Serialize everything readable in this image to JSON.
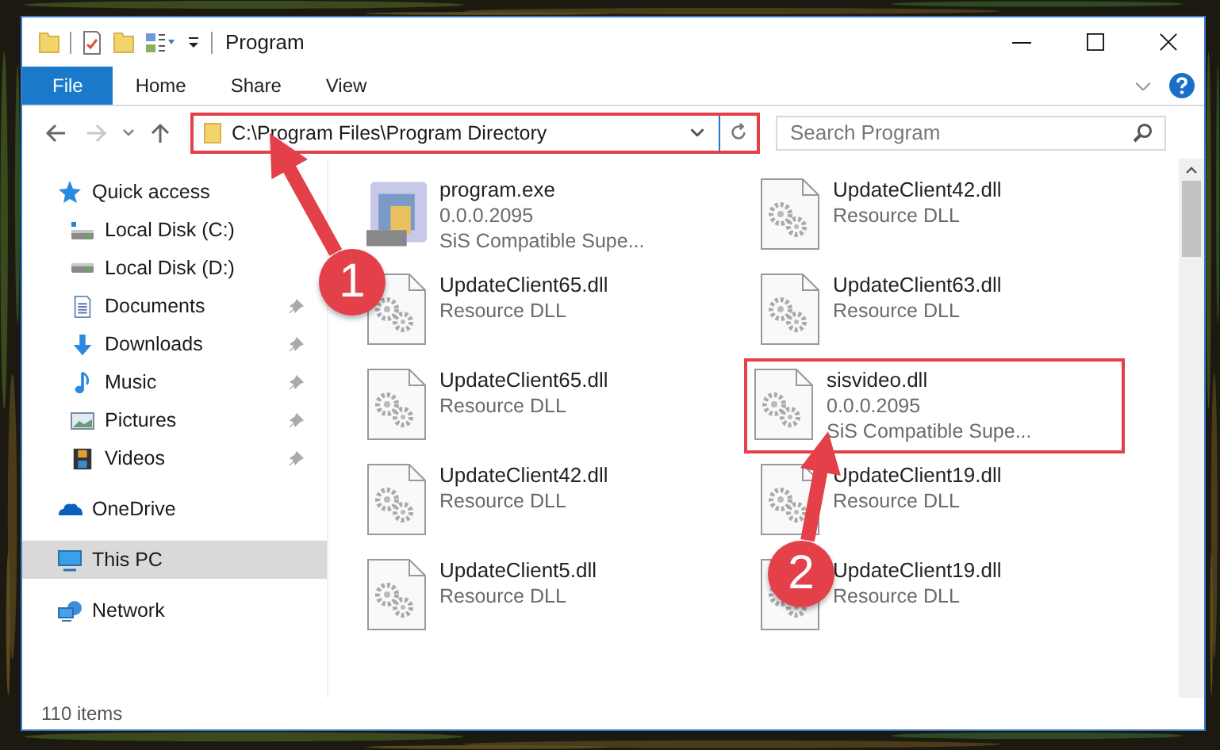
{
  "window": {
    "title": "Program"
  },
  "ribbon": {
    "tabs": [
      {
        "label": "File",
        "selected": true
      },
      {
        "label": "Home",
        "selected": false
      },
      {
        "label": "Share",
        "selected": false
      },
      {
        "label": "View",
        "selected": false
      }
    ]
  },
  "address_bar": {
    "path": "C:\\Program Files\\Program Directory",
    "highlighted": true
  },
  "search": {
    "placeholder": "Search Program"
  },
  "sidebar": {
    "items": [
      {
        "label": "Quick access",
        "selected": false,
        "children": [
          {
            "label": "Local Disk (C:)",
            "pinned": false,
            "selected": false
          },
          {
            "label": "Local Disk (D:)",
            "pinned": false,
            "selected": false
          },
          {
            "label": "Documents",
            "pinned": true,
            "selected": false
          },
          {
            "label": "Downloads",
            "pinned": true,
            "selected": false
          },
          {
            "label": "Music",
            "pinned": true,
            "selected": false
          },
          {
            "label": "Pictures",
            "pinned": true,
            "selected": false
          },
          {
            "label": "Videos",
            "pinned": true,
            "selected": false
          }
        ]
      },
      {
        "label": "OneDrive",
        "selected": false
      },
      {
        "label": "This PC",
        "selected": true
      },
      {
        "label": "Network",
        "selected": false
      }
    ]
  },
  "files": [
    {
      "kind": "exe",
      "name": "program.exe",
      "lines": [
        "0.0.0.2095",
        "SiS Compatible Supe..."
      ],
      "highlighted": false
    },
    {
      "kind": "dll",
      "name": "UpdateClient42.dll",
      "lines": [
        "Resource DLL"
      ],
      "highlighted": false
    },
    {
      "kind": "dll",
      "name": "UpdateClient65.dll",
      "lines": [
        "Resource DLL"
      ],
      "highlighted": false
    },
    {
      "kind": "dll",
      "name": "UpdateClient63.dll",
      "lines": [
        "Resource DLL"
      ],
      "highlighted": false
    },
    {
      "kind": "dll",
      "name": "UpdateClient65.dll",
      "lines": [
        "Resource DLL"
      ],
      "highlighted": false
    },
    {
      "kind": "dll",
      "name": "sisvideo.dll",
      "lines": [
        "0.0.0.2095",
        "SiS Compatible Supe..."
      ],
      "highlighted": true
    },
    {
      "kind": "dll",
      "name": "UpdateClient42.dll",
      "lines": [
        "Resource DLL"
      ],
      "highlighted": false
    },
    {
      "kind": "dll",
      "name": "UpdateClient19.dll",
      "lines": [
        "Resource DLL"
      ],
      "highlighted": false
    },
    {
      "kind": "dll",
      "name": "UpdateClient5.dll",
      "lines": [
        "Resource DLL"
      ],
      "highlighted": false
    },
    {
      "kind": "dll",
      "name": "UpdateClient19.dll",
      "lines": [
        "Resource DLL"
      ],
      "highlighted": false
    }
  ],
  "status_bar": {
    "item_count": "110 items"
  },
  "annotations": [
    {
      "number": "1"
    },
    {
      "number": "2"
    }
  ]
}
